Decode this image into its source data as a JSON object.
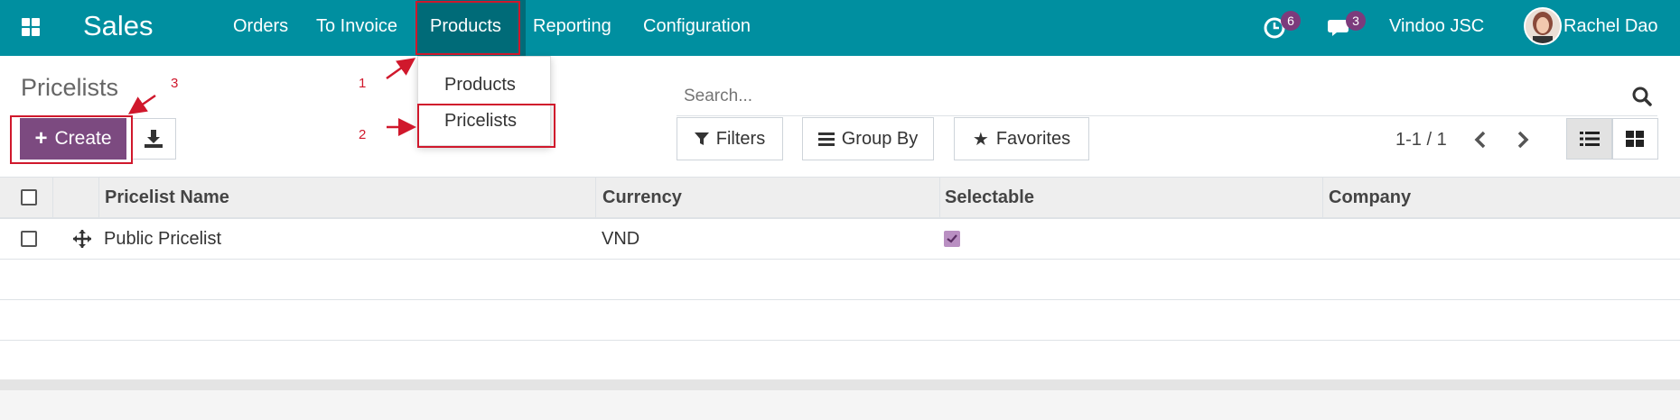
{
  "navbar": {
    "app_title": "Sales",
    "menu": [
      "Orders",
      "To Invoice",
      "Products",
      "Reporting",
      "Configuration"
    ],
    "activity_count": "6",
    "message_count": "3",
    "company": "Vindoo JSC",
    "user": "Rachel Dao"
  },
  "dropdown": {
    "items": [
      "Products",
      "Pricelists"
    ]
  },
  "control_panel": {
    "title": "Pricelists",
    "create_label": "Create",
    "search_placeholder": "Search...",
    "filters_label": "Filters",
    "group_by_label": "Group By",
    "favorites_label": "Favorites",
    "pager": "1-1 / 1"
  },
  "list": {
    "columns": [
      "Pricelist Name",
      "Currency",
      "Selectable",
      "Company"
    ],
    "rows": [
      {
        "name": "Public Pricelist",
        "currency": "VND",
        "selectable": true,
        "company": ""
      }
    ]
  },
  "annotations": {
    "step1": "1",
    "step2": "2",
    "step3": "3"
  },
  "colors": {
    "navbar": "#008fa0",
    "primary": "#7c4a80",
    "annotation": "#d0182c"
  }
}
